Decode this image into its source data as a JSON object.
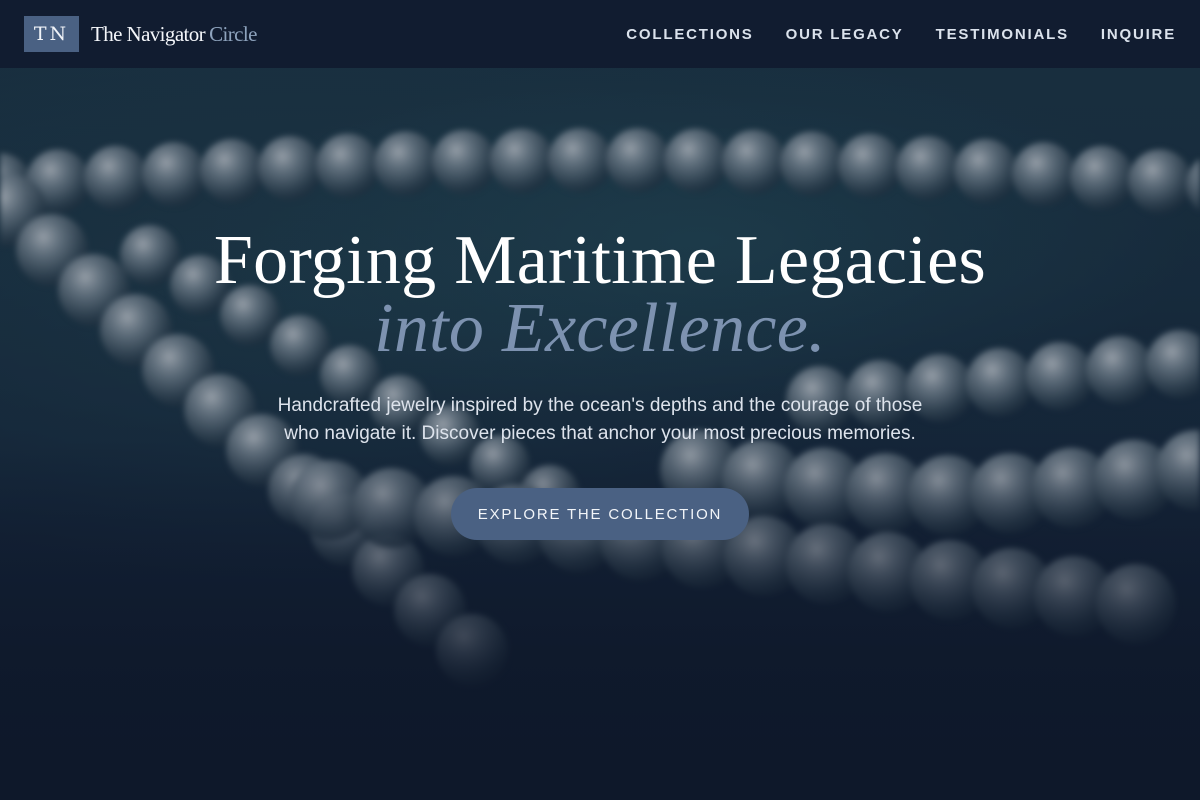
{
  "header": {
    "logo_initials": "TN",
    "brand_name": "The Navigator",
    "brand_accent": "Circle",
    "nav": [
      "COLLECTIONS",
      "OUR LEGACY",
      "TESTIMONIALS",
      "INQUIRE"
    ]
  },
  "hero": {
    "title": "Forging Maritime Legacies",
    "title_accent": "into Excellence.",
    "subtitle": "Handcrafted jewelry inspired by the ocean's depths and the courage of those who navigate it. Discover pieces that anchor your most precious memories.",
    "cta_label": "EXPLORE THE COLLECTION",
    "background_image": "blurred pearl necklace"
  },
  "colors": {
    "header_bg": "#111c30",
    "accent": "#4a6183",
    "accent_text": "#7d92b0",
    "page_bg": "#13203a"
  }
}
